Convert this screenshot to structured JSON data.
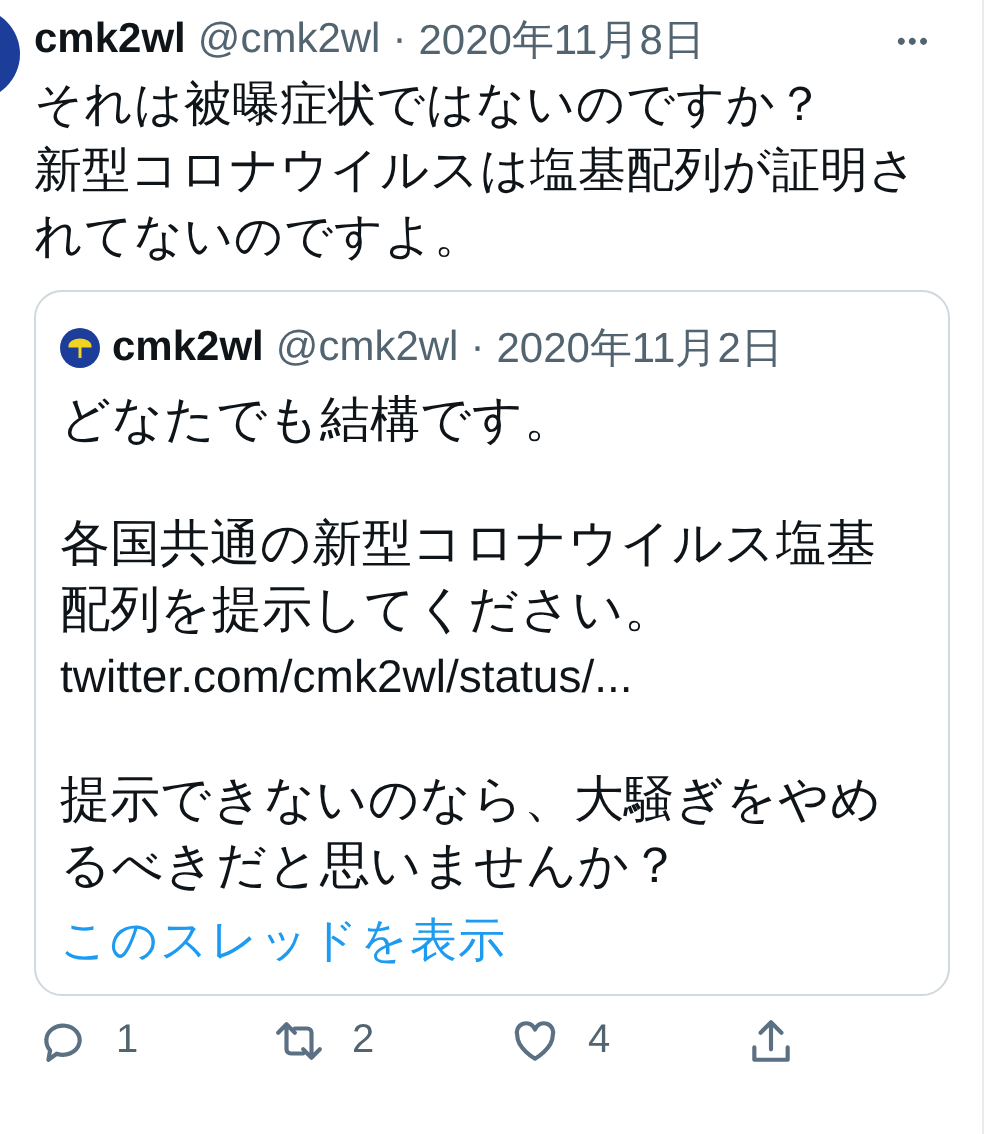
{
  "tweet": {
    "name": "cmk2wl",
    "handle": "@cmk2wl",
    "separator": "·",
    "date": "2020年11月8日",
    "more": "•••",
    "text": [
      "それは被曝症状ではないのですか？",
      "新型コロナウイルスは塩基配列が証明されてないのですよ。"
    ]
  },
  "quote": {
    "name": "cmk2wl",
    "handle": "@cmk2wl",
    "separator": "·",
    "date": "2020年11月2日",
    "paragraphs": [
      "どなたでも結構です。",
      "各国共通の新型コロナウイルス塩基配列を提示してください。"
    ],
    "link": "twitter.com/cmk2wl/status/...",
    "paragraphs_after": [
      "提示できないのなら、大騒ぎをやめるべきだと思いませんか？"
    ],
    "thread_link": "このスレッドを表示"
  },
  "actions": [
    {
      "kind": "reply",
      "count": "1"
    },
    {
      "kind": "retweet",
      "count": "2"
    },
    {
      "kind": "like",
      "count": "4"
    },
    {
      "kind": "share"
    }
  ]
}
